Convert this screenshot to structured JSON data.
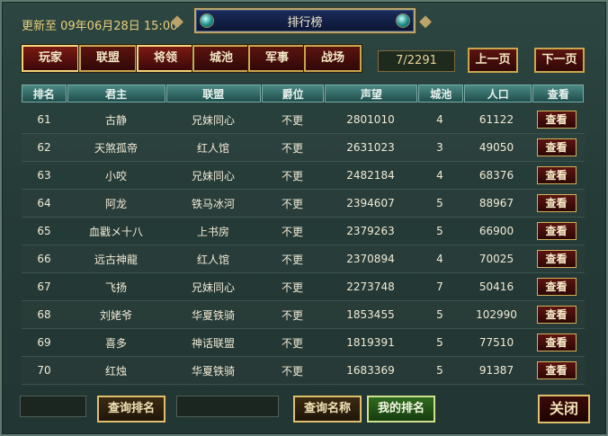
{
  "header": {
    "update_label": "更新至 09年06月28日 15:00",
    "title": "排行榜"
  },
  "tabs": [
    {
      "label": "玩家",
      "active": true
    },
    {
      "label": "联盟",
      "active": false
    },
    {
      "label": "将领",
      "active": true
    },
    {
      "label": "城池",
      "active": false
    },
    {
      "label": "军事",
      "active": false
    },
    {
      "label": "战场",
      "active": false
    }
  ],
  "pagination": {
    "indicator": "7/2291",
    "prev_label": "上一页",
    "next_label": "下一页"
  },
  "table": {
    "columns": [
      "排名",
      "君主",
      "联盟",
      "爵位",
      "声望",
      "城池",
      "人口",
      "查看"
    ],
    "rows": [
      {
        "rank": "61",
        "lord": "古静",
        "alliance": "兄妹同心",
        "title": "不更",
        "prestige": "2801010",
        "cities": "4",
        "population": "61122",
        "view": "查看"
      },
      {
        "rank": "62",
        "lord": "天煞孤帝",
        "alliance": "红人馆",
        "title": "不更",
        "prestige": "2631023",
        "cities": "3",
        "population": "49050",
        "view": "查看"
      },
      {
        "rank": "63",
        "lord": "小咬",
        "alliance": "兄妹同心",
        "title": "不更",
        "prestige": "2482184",
        "cities": "4",
        "population": "68376",
        "view": "查看"
      },
      {
        "rank": "64",
        "lord": "阿龙",
        "alliance": "铁马冰河",
        "title": "不更",
        "prestige": "2394607",
        "cities": "5",
        "population": "88967",
        "view": "查看"
      },
      {
        "rank": "65",
        "lord": "血戳メ十八",
        "alliance": "上书房",
        "title": "不更",
        "prestige": "2379263",
        "cities": "5",
        "population": "66900",
        "view": "查看"
      },
      {
        "rank": "66",
        "lord": "远古神龍",
        "alliance": "红人馆",
        "title": "不更",
        "prestige": "2370894",
        "cities": "4",
        "population": "70025",
        "view": "查看"
      },
      {
        "rank": "67",
        "lord": "飞扬",
        "alliance": "兄妹同心",
        "title": "不更",
        "prestige": "2273748",
        "cities": "7",
        "population": "50416",
        "view": "查看"
      },
      {
        "rank": "68",
        "lord": "刘姥爷",
        "alliance": "华夏铁骑",
        "title": "不更",
        "prestige": "1853455",
        "cities": "5",
        "population": "102990",
        "view": "查看"
      },
      {
        "rank": "69",
        "lord": "喜多",
        "alliance": "神话联盟",
        "title": "不更",
        "prestige": "1819391",
        "cities": "5",
        "population": "77510",
        "view": "查看"
      },
      {
        "rank": "70",
        "lord": "红烛",
        "alliance": "华夏铁骑",
        "title": "不更",
        "prestige": "1683369",
        "cities": "5",
        "population": "91387",
        "view": "查看"
      }
    ]
  },
  "footer": {
    "rank_input_value": "",
    "query_rank_label": "查询排名",
    "name_input_value": "",
    "query_name_label": "查询名称",
    "my_rank_label": "我的排名",
    "close_label": "关闭"
  }
}
